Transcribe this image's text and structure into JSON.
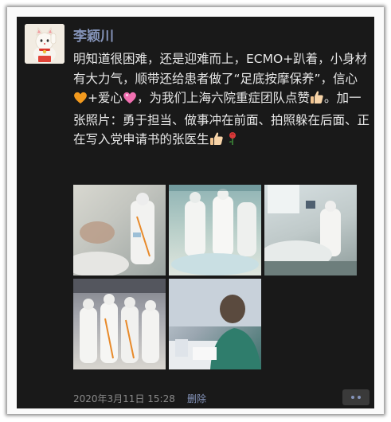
{
  "post": {
    "author": "李颖川",
    "text_1": "明知道很困难，还是迎难而上，ECMO+趴着，小身材有大力气，顺带还给患者做了“足底按摩保养”，信心",
    "text_2": "+爱心",
    "text_3": "，为我们上海六院重症团队点赞",
    "text_4": "。加一张照片：勇于担当、做事冲在前面、拍照躲在后面、正在写入党申请书的张医生",
    "timestamp": "2020年3月11日 15:28",
    "delete_label": "删除",
    "emojis": [
      "orange-heart-icon",
      "pink-heart-icon",
      "thumbs-up-icon",
      "thumbs-up-icon",
      "rose-icon"
    ],
    "photos": [
      {
        "name": "photo-1"
      },
      {
        "name": "photo-2"
      },
      {
        "name": "photo-3"
      },
      {
        "name": "photo-4"
      },
      {
        "name": "photo-5"
      }
    ]
  },
  "colors": {
    "background": "#191919",
    "author_name": "#8594ba",
    "body_text": "#e8e8e8",
    "timestamp": "#8a8a8a"
  }
}
